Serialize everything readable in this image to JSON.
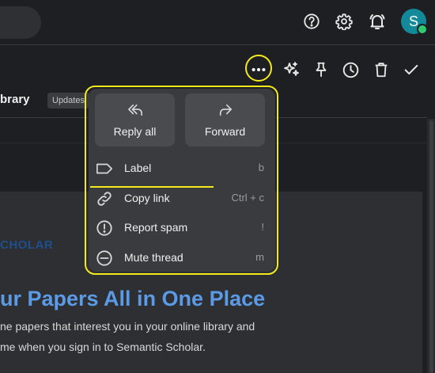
{
  "header": {
    "help_icon": "help-circle-icon",
    "settings_icon": "gear-icon",
    "notifications_icon": "bell-ring-icon",
    "avatar_initial": "S",
    "avatar_color": "#138a99"
  },
  "toolbar": {
    "icons": [
      "more-horizontal-icon",
      "sparkle-icon",
      "pin-icon",
      "clock-icon",
      "trash-icon",
      "check-icon"
    ]
  },
  "thread": {
    "subject": "brary",
    "badge": "Updates"
  },
  "email": {
    "brand": "CHOLAR",
    "brand_color": "#1d4f8c",
    "headline": "ur Papers All in One Place",
    "headline_color": "#5b9be6",
    "line1": "ne papers that interest you in your online library and",
    "line2": "me when you sign in to Semantic Scholar."
  },
  "menu": {
    "reply_all": "Reply all",
    "forward": "Forward",
    "items": [
      {
        "label": "Label",
        "shortcut": "b",
        "icon": "label-tag-icon"
      },
      {
        "label": "Copy link",
        "shortcut": "Ctrl + c",
        "icon": "link-icon"
      },
      {
        "label": "Report spam",
        "shortcut": "!",
        "icon": "alert-circle-icon"
      },
      {
        "label": "Mute thread",
        "shortcut": "m",
        "icon": "mute-minus-circle-icon"
      }
    ]
  },
  "colors": {
    "highlight": "#f4ea1b",
    "menu_bg": "#3a3b3e",
    "page_bg": "#1e1f22"
  }
}
